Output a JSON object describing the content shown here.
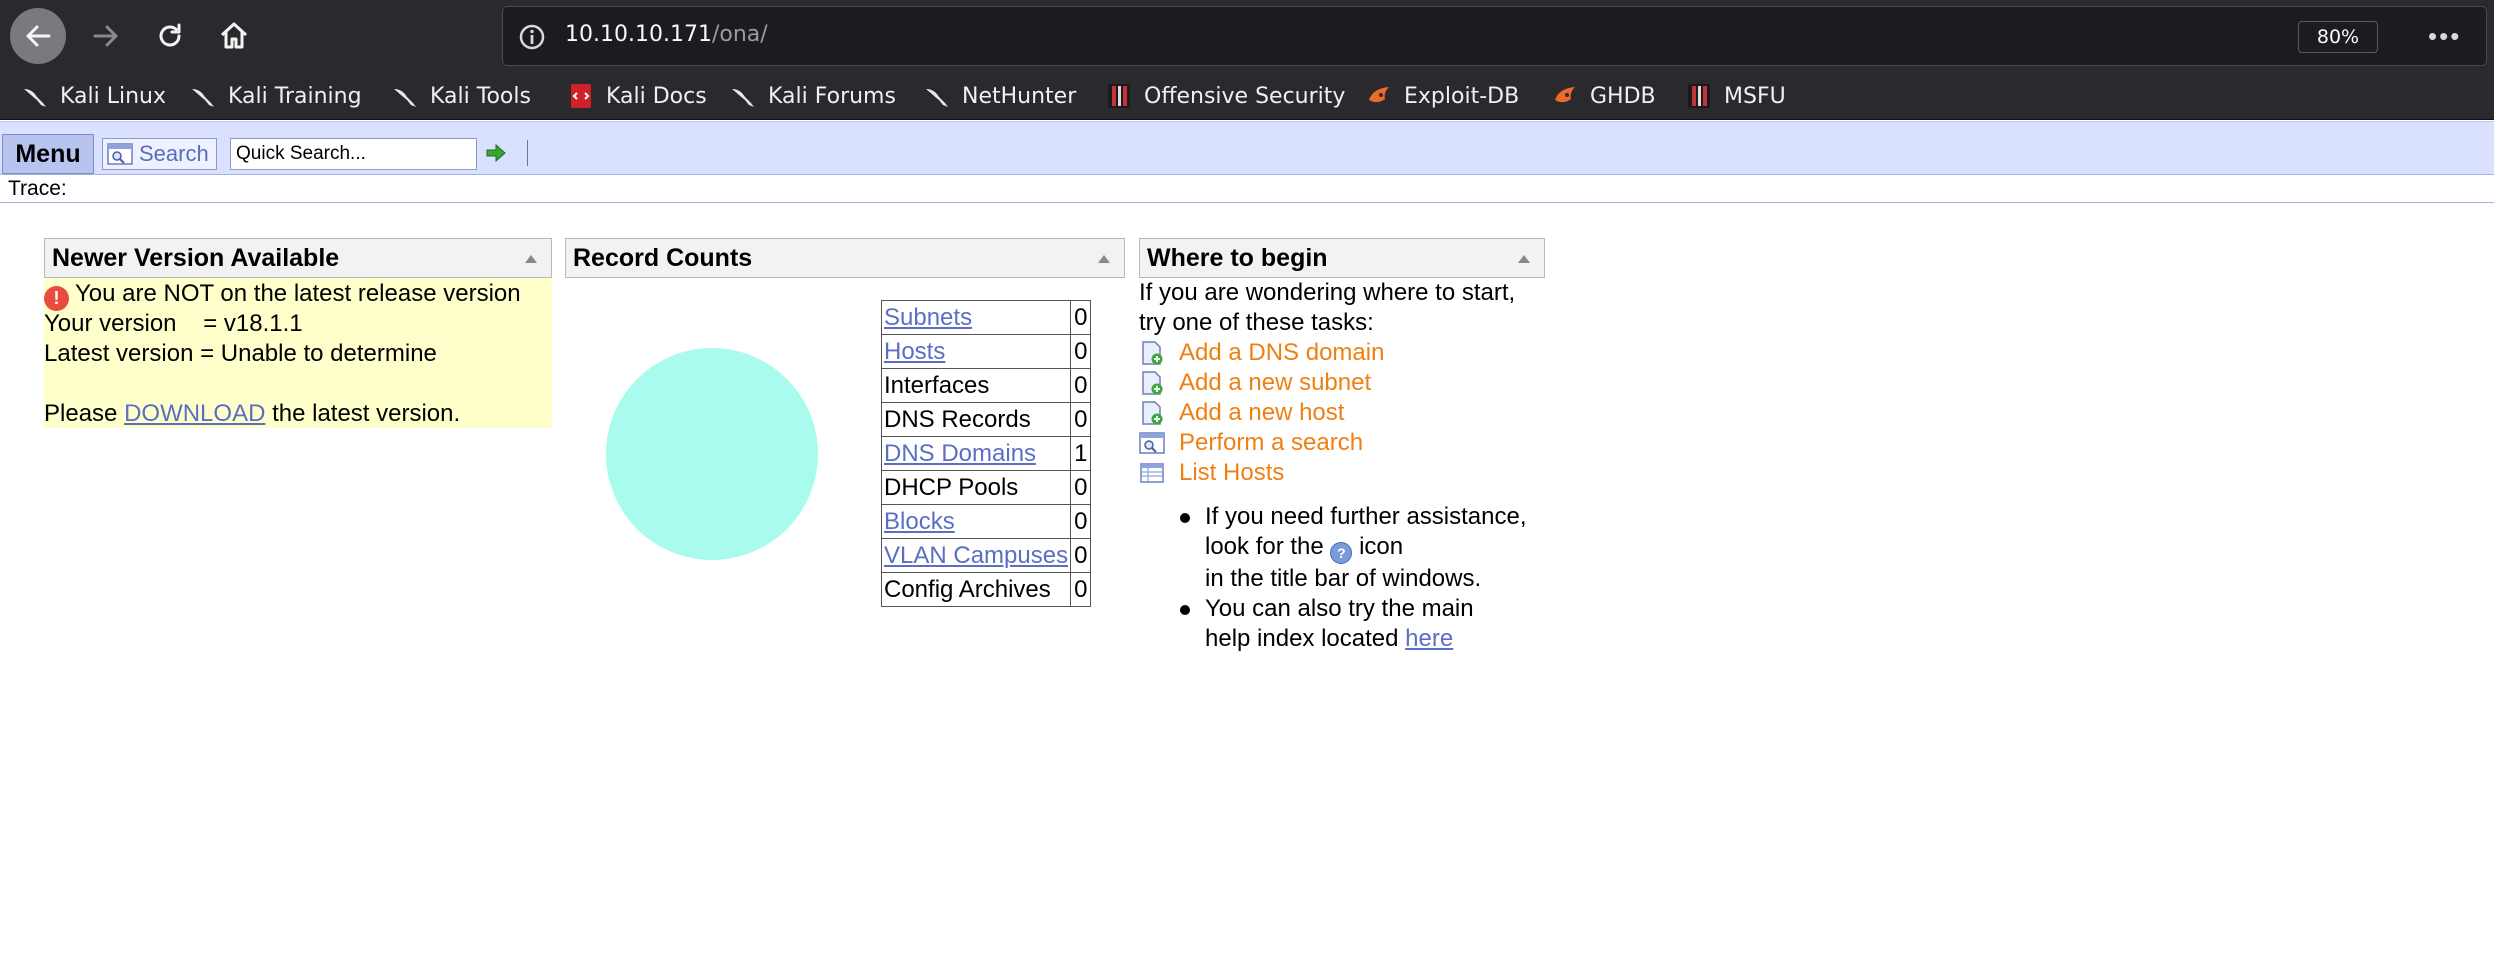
{
  "browser": {
    "url_host": "10.10.10.171",
    "url_path": "/ona/",
    "zoom": "80%",
    "page_actions": "•••",
    "bookmarks": [
      {
        "label": "Kali Linux",
        "icon": "kali-dragon-icon"
      },
      {
        "label": "Kali Training",
        "icon": "kali-dragon-icon"
      },
      {
        "label": "Kali Tools",
        "icon": "kali-dragon-icon"
      },
      {
        "label": "Kali Docs",
        "icon": "kali-docs-icon"
      },
      {
        "label": "Kali Forums",
        "icon": "kali-dragon-icon"
      },
      {
        "label": "NetHunter",
        "icon": "kali-dragon-icon"
      },
      {
        "label": "Offensive Security",
        "icon": "offsec-icon"
      },
      {
        "label": "Exploit-DB",
        "icon": "exploit-db-icon"
      },
      {
        "label": "GHDB",
        "icon": "exploit-db-icon"
      },
      {
        "label": "MSFU",
        "icon": "offsec-icon"
      }
    ]
  },
  "menubar": {
    "menu_label": "Menu",
    "search_label": "Search",
    "quick_search_value": "Quick Search..."
  },
  "trace": {
    "label": "Trace:"
  },
  "newer_version": {
    "title": "Newer Version Available",
    "alert_glyph": "!",
    "warning": "You are NOT on the latest release version",
    "your_version": "Your version    = v18.1.1",
    "latest_version": "Latest version = Unable to determine",
    "please_prefix": "Please ",
    "download_link": "DOWNLOAD",
    "please_suffix": " the latest version."
  },
  "record_counts": {
    "title": "Record Counts",
    "rows": [
      {
        "label": "Subnets",
        "count": "0",
        "link": true
      },
      {
        "label": "Hosts",
        "count": "0",
        "link": true
      },
      {
        "label": "Interfaces",
        "count": "0",
        "link": false
      },
      {
        "label": "DNS Records",
        "count": "0",
        "link": false
      },
      {
        "label": "DNS Domains",
        "count": "1",
        "link": true
      },
      {
        "label": "DHCP Pools",
        "count": "0",
        "link": false
      },
      {
        "label": "Blocks",
        "count": "0",
        "link": true
      },
      {
        "label": "VLAN Campuses",
        "count": "0",
        "link": true
      },
      {
        "label": "Config Archives",
        "count": "0",
        "link": false
      }
    ],
    "chart_color": "#a9fbed"
  },
  "where_to_begin": {
    "title": "Where to begin",
    "intro_line1": "If you are wondering where to start,",
    "intro_line2": "try one of these tasks:",
    "tasks": [
      {
        "label": "Add a DNS domain",
        "icon": "add-page-icon"
      },
      {
        "label": "Add a new subnet",
        "icon": "add-page-icon"
      },
      {
        "label": "Add a new host",
        "icon": "add-page-icon"
      },
      {
        "label": "Perform a search",
        "icon": "search-window-icon"
      },
      {
        "label": "List Hosts",
        "icon": "list-table-icon"
      }
    ],
    "help1_line1": "If you need further assistance,",
    "help1_line2_prefix": "look for the ",
    "help1_line2_suffix": " icon",
    "help1_line3": "in the title bar of windows.",
    "help2_line1": "You can also try the main",
    "help2_line2_prefix": "help index located ",
    "help2_link": "here"
  },
  "colors": {
    "toolbar_bg": "#2a2a2e",
    "menubar_bg": "#d9e1ff",
    "link": "#5b6fc2",
    "task_link": "#f07f11",
    "version_bg": "#ffffcc"
  }
}
